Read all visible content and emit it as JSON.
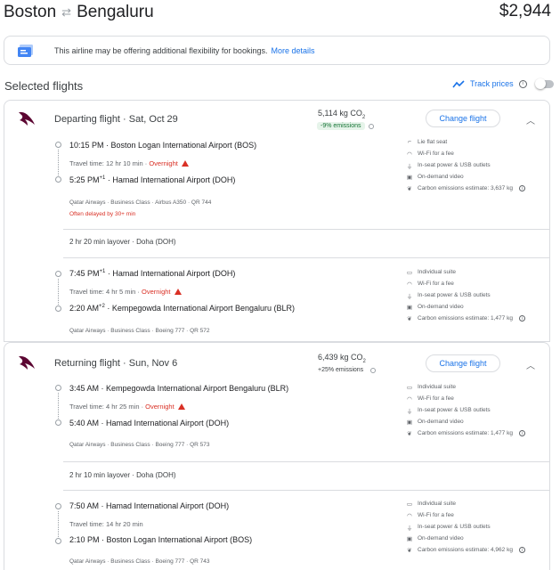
{
  "header": {
    "origin": "Boston",
    "destination": "Bengaluru",
    "price": "$2,944"
  },
  "banner": {
    "text": "This airline may be offering additional flexibility for bookings.",
    "link": "More details"
  },
  "section": {
    "title": "Selected flights",
    "track_label": "Track prices"
  },
  "colors": {
    "accent": "#1a73e8",
    "warning": "#d93025",
    "eco_badge_bg": "#e6f4ea",
    "airline_logo": "#5c0632"
  },
  "departing": {
    "title": "Departing flight · Sat, Oct 29",
    "emissions": "5,114 kg CO",
    "emissions_sub": "2",
    "emissions_delta": "-9% emissions",
    "change_label": "Change flight",
    "seg1": {
      "dep_time": "10:15 PM",
      "dep_airport": "Boston Logan International Airport (BOS)",
      "travel": "Travel time: 12 hr 10 min",
      "overnight": "Overnight",
      "arr_time": "5:25 PM",
      "arr_sup": "+1",
      "arr_airport": "Hamad International Airport (DOH)",
      "meta": "Qatar Airways · Business Class · Airbus A350 · QR 744",
      "delay": "Often delayed by 30+ min",
      "amenities": [
        "Lie flat seat",
        "Wi-Fi for a fee",
        "In-seat power & USB outlets",
        "On-demand video"
      ],
      "carbon": "Carbon emissions estimate: 3,637 kg"
    },
    "layover": "2 hr 20 min layover · Doha (DOH)",
    "seg2": {
      "dep_time": "7:45 PM",
      "dep_sup": "+1",
      "dep_airport": "Hamad International Airport (DOH)",
      "travel": "Travel time: 4 hr 5 min",
      "overnight": "Overnight",
      "arr_time": "2:20 AM",
      "arr_sup": "+2",
      "arr_airport": "Kempegowda International Airport Bengaluru (BLR)",
      "meta": "Qatar Airways · Business Class · Boeing 777 · QR 572",
      "amenities": [
        "Individual suite",
        "Wi-Fi for a fee",
        "In-seat power & USB outlets",
        "On-demand video"
      ],
      "carbon": "Carbon emissions estimate: 1,477 kg"
    }
  },
  "returning": {
    "title": "Returning flight · Sun, Nov 6",
    "emissions": "6,439 kg CO",
    "emissions_sub": "2",
    "emissions_delta": "+25% emissions",
    "change_label": "Change flight",
    "seg1": {
      "dep_time": "3:45 AM",
      "dep_airport": "Kempegowda International Airport Bengaluru (BLR)",
      "travel": "Travel time: 4 hr 25 min",
      "overnight": "Overnight",
      "arr_time": "5:40 AM",
      "arr_airport": "Hamad International Airport (DOH)",
      "meta": "Qatar Airways · Business Class · Boeing 777 · QR 573",
      "amenities": [
        "Individual suite",
        "Wi-Fi for a fee",
        "In-seat power & USB outlets",
        "On-demand video"
      ],
      "carbon": "Carbon emissions estimate: 1,477 kg"
    },
    "layover": "2 hr 10 min layover · Doha (DOH)",
    "seg2": {
      "dep_time": "7:50 AM",
      "dep_airport": "Hamad International Airport (DOH)",
      "travel": "Travel time: 14 hr 20 min",
      "arr_time": "2:10 PM",
      "arr_airport": "Boston Logan International Airport (BOS)",
      "meta": "Qatar Airways · Business Class · Boeing 777 · QR 743",
      "amenities": [
        "Individual suite",
        "Wi-Fi for a fee",
        "In-seat power & USB outlets",
        "On-demand video"
      ],
      "carbon": "Carbon emissions estimate: 4,962 kg"
    }
  }
}
